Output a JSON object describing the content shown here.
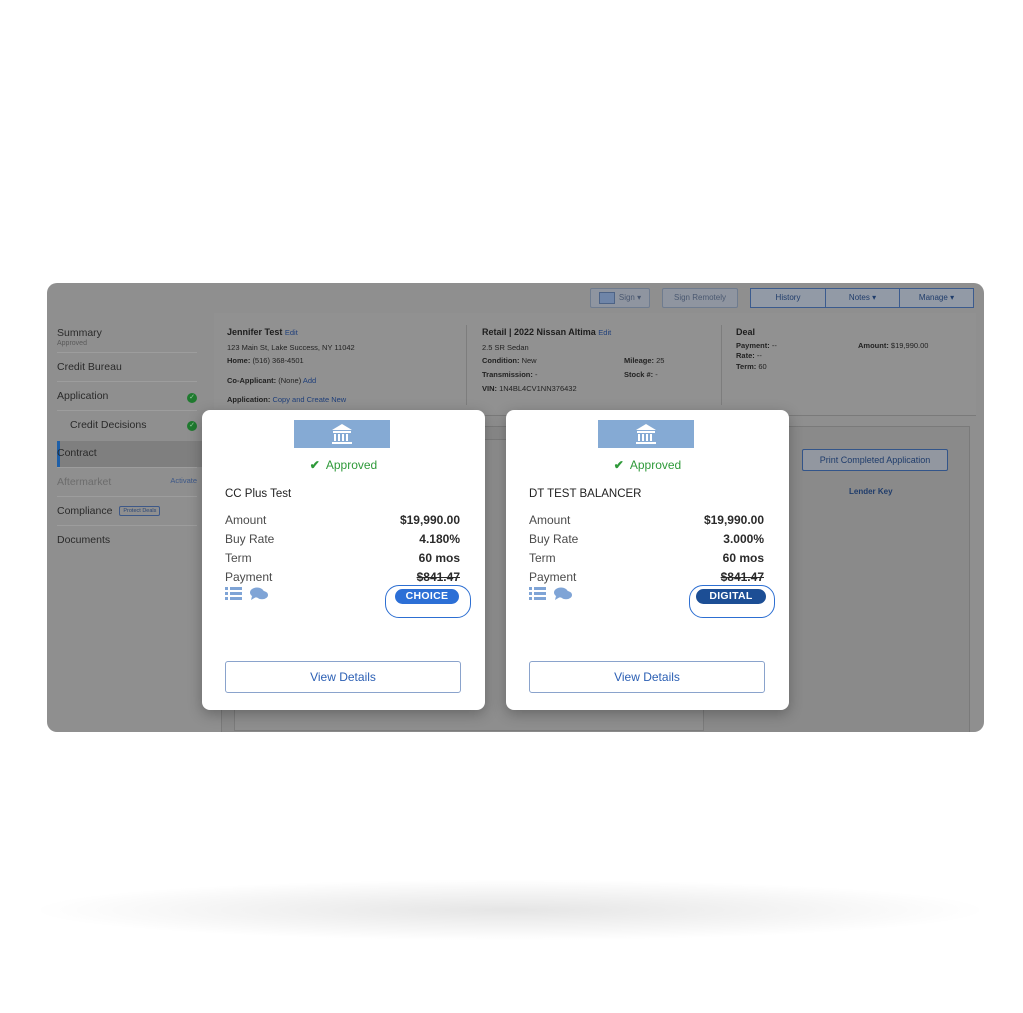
{
  "toolbar": {
    "sign_label": "Sign",
    "sign_remotely_label": "Sign Remotely",
    "history_label": "History",
    "notes_label": "Notes",
    "manage_label": "Manage"
  },
  "sidebar": {
    "items": [
      {
        "label": "Summary",
        "sublabel": "Approved"
      },
      {
        "label": "Credit Bureau"
      },
      {
        "label": "Application"
      },
      {
        "label": "Credit Decisions"
      },
      {
        "label": "Contract"
      },
      {
        "label": "Aftermarket",
        "action": "Activate"
      },
      {
        "label": "Compliance",
        "badge": "Protect Deals"
      },
      {
        "label": "Documents"
      }
    ]
  },
  "applicant": {
    "name": "Jennifer Test",
    "edit": "Edit",
    "address": "123 Main St, Lake Success, NY 11042",
    "home_label": "Home:",
    "home_value": "(516) 368-4501",
    "coapplicant_label": "Co-Applicant:",
    "coapplicant_value": "(None)",
    "coapplicant_add": "Add",
    "application_label": "Application:",
    "application_link": "Copy and Create New"
  },
  "vehicle": {
    "title": "Retail | 2022 Nissan Altima",
    "edit": "Edit",
    "trim": "2.5 SR Sedan",
    "condition_label": "Condition:",
    "condition_value": "New",
    "transmission_label": "Transmission:",
    "transmission_value": "-",
    "vin_label": "VIN:",
    "vin_value": "1N4BL4CV1NN376432",
    "mileage_label": "Mileage:",
    "mileage_value": "25",
    "stock_label": "Stock #:",
    "stock_value": "-"
  },
  "deal": {
    "title": "Deal",
    "payment_label": "Payment:",
    "payment_value": "--",
    "rate_label": "Rate:",
    "rate_value": "--",
    "term_label": "Term:",
    "term_value": "60",
    "amount_label": "Amount:",
    "amount_value": "$19,990.00"
  },
  "panel": {
    "print_label": "Print Completed Application",
    "lender_key": "Lender Key"
  },
  "cards": [
    {
      "status": "Approved",
      "lender": "CC Plus Test",
      "rows": [
        {
          "label": "Amount",
          "value": "$19,990.00"
        },
        {
          "label": "Buy Rate",
          "value": "4.180%"
        },
        {
          "label": "Term",
          "value": "60 mos"
        },
        {
          "label": "Payment",
          "value": "$841.47"
        }
      ],
      "badge": "CHOICE",
      "view_label": "View Details"
    },
    {
      "status": "Approved",
      "lender": "DT TEST BALANCER",
      "rows": [
        {
          "label": "Amount",
          "value": "$19,990.00"
        },
        {
          "label": "Buy Rate",
          "value": "3.000%"
        },
        {
          "label": "Term",
          "value": "60 mos"
        },
        {
          "label": "Payment",
          "value": "$841.47"
        }
      ],
      "badge": "DIGITAL",
      "view_label": "View Details"
    }
  ],
  "colors": {
    "approved_green": "#2f9a3a",
    "choice_badge": "#2c6fd6",
    "digital_badge": "#1c4e95",
    "link_blue": "#2b5fb4"
  }
}
